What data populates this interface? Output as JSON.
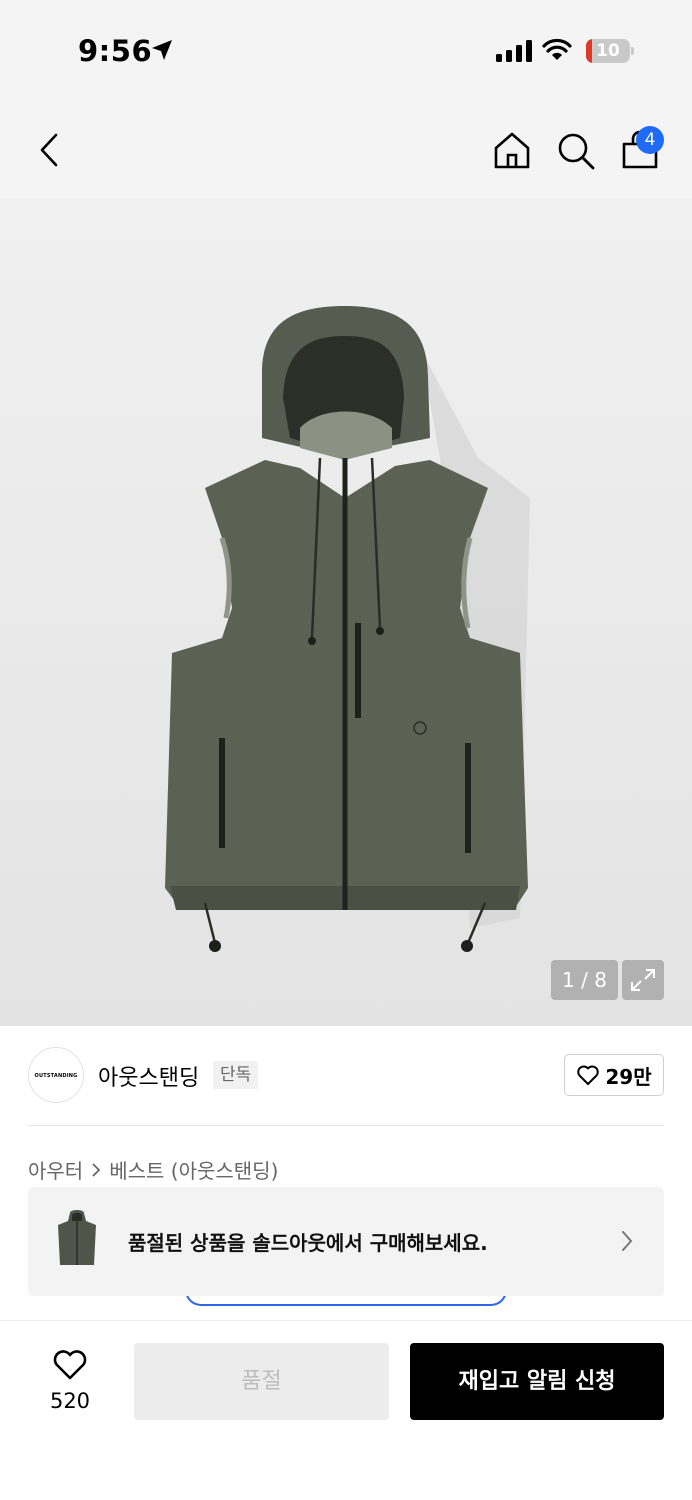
{
  "status_bar": {
    "time": "9:56",
    "battery": "10"
  },
  "header": {
    "cart_count": "4"
  },
  "gallery": {
    "counter": "1 / 8"
  },
  "brand": {
    "logo_text": "OUTSTANDING",
    "name": "아웃스탠딩",
    "tag": "단독",
    "likes": "29만"
  },
  "breadcrumb": {
    "level1": "아우터",
    "level2": "베스트 (아웃스탠딩)"
  },
  "soldout_banner": {
    "text": "품절된 상품을 솔드아웃에서 구매해보세요."
  },
  "bottom_bar": {
    "wish_count": "520",
    "sold_out_label": "품절",
    "restock_label": "재입고 알림 신청"
  },
  "colors": {
    "accent_blue": "#1f6bf5",
    "battery_low": "#e0372b",
    "primary_button": "#000000",
    "disabled_button": "#ececec"
  }
}
